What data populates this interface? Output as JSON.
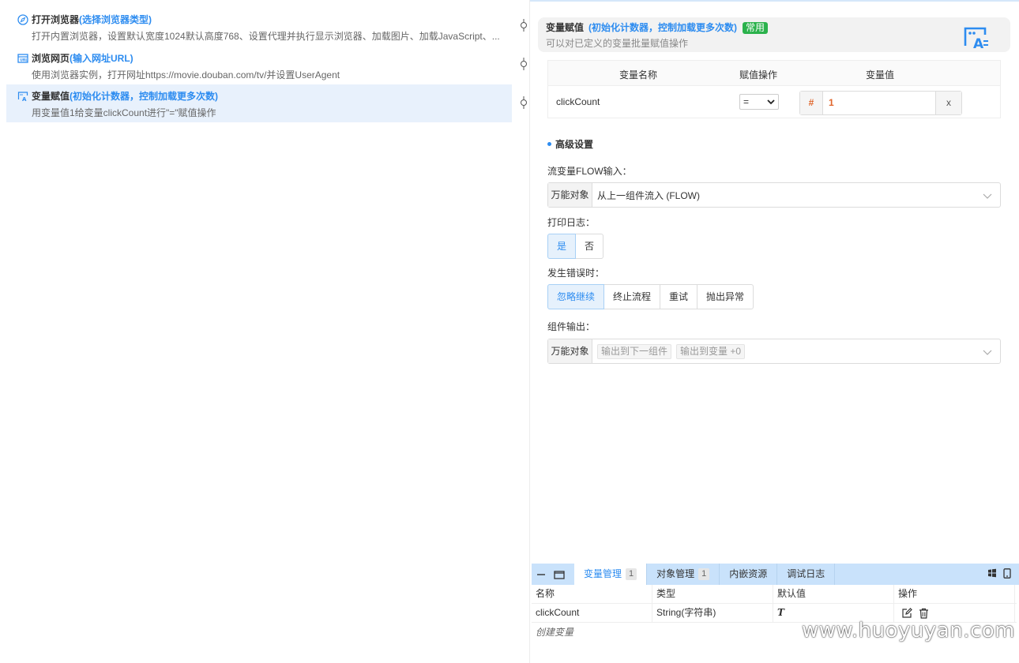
{
  "flow": {
    "items": [
      {
        "title": "打开浏览器",
        "hint": "(选择浏览器类型)",
        "desc": "打开内置浏览器，设置默认宽度1024默认高度768、设置代理并执行显示浏览器、加载图片、加载JavaScript、...",
        "icon": "compass-icon"
      },
      {
        "title": "浏览网页",
        "hint": "(输入网址URL)",
        "desc": "使用浏览器实例，打开网址https://movie.douban.com/tv/并设置UserAgent",
        "icon": "browser-window-icon"
      },
      {
        "title": "变量赋值",
        "hint": "(初始化计数器，控制加载更多次数)",
        "desc": "用变量值1给变量clickCount进行\"=\"赋值操作",
        "icon": "variable-assign-icon"
      }
    ]
  },
  "panel": {
    "title": "变量赋值",
    "hint": "(初始化计数器，控制加载更多次数)",
    "badge": "常用",
    "desc": "可以对已定义的变量批量赋值操作",
    "table": {
      "headers": [
        "变量名称",
        "赋值操作",
        "变量值"
      ],
      "row": {
        "name": "clickCount",
        "op": "=",
        "type_icon": "#",
        "value": "1",
        "remove": "x"
      }
    },
    "advanced_title": "高级设置",
    "flow_input_label": "流变量FLOW输入：",
    "flow_input_addon": "万能对象",
    "flow_input_value": "从上一组件流入 (FLOW)",
    "log_label": "打印日志：",
    "log_options": [
      "是",
      "否"
    ],
    "error_label": "发生错误时：",
    "error_options": [
      "忽略继续",
      "终止流程",
      "重试",
      "抛出异常"
    ],
    "output_label": "组件输出：",
    "output_addon": "万能对象",
    "output_tags": [
      "输出到下一组件",
      "输出到变量 +0"
    ]
  },
  "bottom": {
    "tabs": [
      {
        "label": "变量管理",
        "count": "1"
      },
      {
        "label": "对象管理",
        "count": "1"
      },
      {
        "label": "内嵌资源",
        "count": ""
      },
      {
        "label": "调试日志",
        "count": ""
      }
    ],
    "columns": [
      "名称",
      "类型",
      "默认值",
      "操作"
    ],
    "rows": [
      {
        "name": "clickCount",
        "type": "String(字符串)",
        "default": "T"
      }
    ],
    "create_label": "创建变量"
  },
  "watermark": "www.huoyuyan.com",
  "colors": {
    "accent": "#2d8cf0",
    "badge": "#2bb24c",
    "active_bg": "#e8f1fc",
    "tabbar": "#c9e2fb"
  }
}
